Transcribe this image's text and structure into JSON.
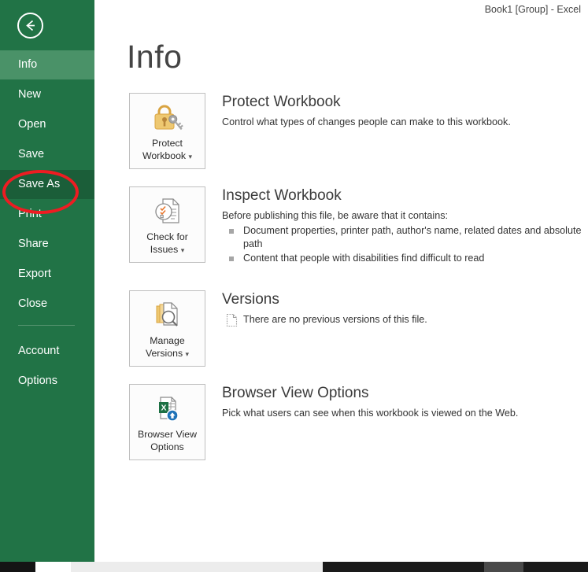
{
  "window": {
    "title": "Book1  [Group] - Excel"
  },
  "sidebar": {
    "back_icon": "back-arrow-icon",
    "items": [
      {
        "label": "Info",
        "state": "active"
      },
      {
        "label": "New",
        "state": "normal"
      },
      {
        "label": "Open",
        "state": "normal"
      },
      {
        "label": "Save",
        "state": "normal"
      },
      {
        "label": "Save As",
        "state": "hovered"
      },
      {
        "label": "Print",
        "state": "normal"
      },
      {
        "label": "Share",
        "state": "normal"
      },
      {
        "label": "Export",
        "state": "normal"
      },
      {
        "label": "Close",
        "state": "normal"
      }
    ],
    "footer_items": [
      {
        "label": "Account"
      },
      {
        "label": "Options"
      }
    ]
  },
  "annotation": {
    "shape": "ellipse",
    "color": "#ee1c22",
    "targets": "Save As"
  },
  "main": {
    "page_title": "Info",
    "sections": [
      {
        "button": {
          "line1": "Protect",
          "line2": "Workbook",
          "caret": "▾",
          "icon": "lock-and-key-icon"
        },
        "title": "Protect Workbook",
        "description": "Control what types of changes people can make to this workbook."
      },
      {
        "button": {
          "line1": "Check for",
          "line2": "Issues",
          "caret": "▾",
          "icon": "document-inspect-icon"
        },
        "title": "Inspect Workbook",
        "description": "Before publishing this file, be aware that it contains:",
        "bullets": [
          "Document properties, printer path, author's name, related dates and absolute path",
          "Content that people with disabilities find difficult to read"
        ]
      },
      {
        "button": {
          "line1": "Manage",
          "line2": "Versions",
          "caret": "▾",
          "icon": "manage-versions-icon"
        },
        "title": "Versions",
        "version_note": "There are no previous versions of this file.",
        "version_note_icon": "dotted-document-icon"
      },
      {
        "button": {
          "line1": "Browser View",
          "line2": "Options",
          "caret": "",
          "icon": "browser-view-excel-icon"
        },
        "title": "Browser View Options",
        "description": "Pick what users can see when this workbook is viewed on the Web."
      }
    ]
  },
  "colors": {
    "sidebar_green": "#217346",
    "sidebar_active": "#4a9268",
    "sidebar_hover": "#1b5e39",
    "annotation_red": "#ee1c22",
    "excel_green": "#1d7044",
    "gold": "#e3b969"
  }
}
